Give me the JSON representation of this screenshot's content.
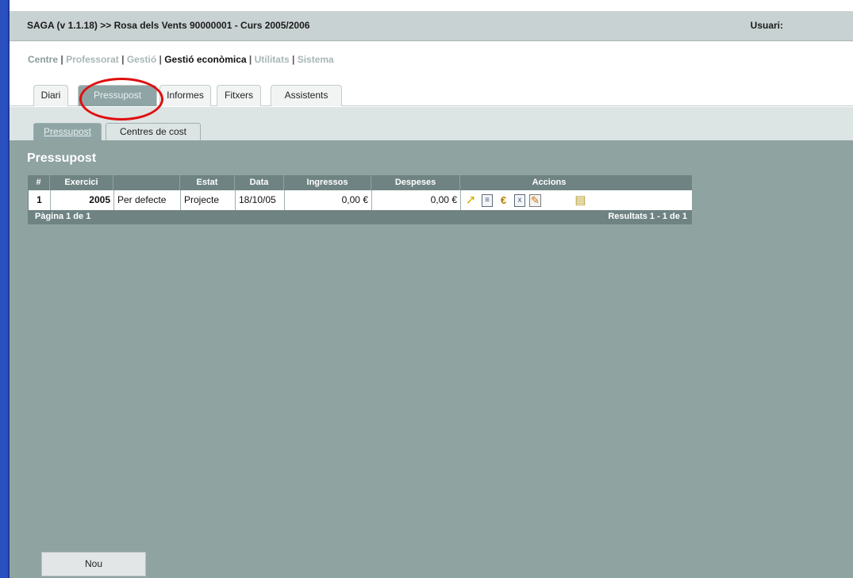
{
  "header": {
    "title": "SAGA (v 1.1.18) >> Rosa dels Vents 90000001 - Curs 2005/2006",
    "user_label": "Usuari:"
  },
  "nav": {
    "items": [
      {
        "label": "Centre",
        "style": "grey"
      },
      {
        "label": "Professorat",
        "style": "light"
      },
      {
        "label": "Gestió",
        "style": "light"
      },
      {
        "label": "Gestió econòmica",
        "style": "active"
      },
      {
        "label": "Utilitats",
        "style": "light"
      },
      {
        "label": "Sistema",
        "style": "light"
      }
    ],
    "separator": "|"
  },
  "tabs": [
    {
      "label": "Diari"
    },
    {
      "label": "Pressupost",
      "active": true
    },
    {
      "label": "Informes"
    },
    {
      "label": "Fitxers"
    },
    {
      "label": "Assistents"
    }
  ],
  "subtabs": [
    {
      "label": "Pressupost",
      "active": true
    },
    {
      "label": "Centres de cost"
    }
  ],
  "page": {
    "title": "Pressupost"
  },
  "table": {
    "columns": [
      "#",
      "Exercici",
      "",
      "Estat",
      "Data",
      "Ingressos",
      "Despeses",
      "Accions"
    ],
    "rows": [
      {
        "num": "1",
        "exercici": "2005",
        "descripcio": "Per defecte",
        "estat": "Projecte",
        "data": "18/10/05",
        "ingressos": "0,00 €",
        "despeses": "0,00 €"
      }
    ],
    "footer_left": "Pàgina 1 de 1",
    "footer_right": "Resultats 1 - 1 de 1",
    "action_icons": [
      "select-arrow-icon",
      "document-icon",
      "euro-icon",
      "excel-icon",
      "edit-pencil-icon",
      "printer-icon"
    ]
  },
  "buttons": {
    "new_label": "Nou"
  },
  "colors": {
    "content_bg": "#8fa3a1",
    "table_header": "#6f8383",
    "active_tab": "#8fa5a5",
    "annotation": "#e01010",
    "window_border": "#2a4fbf"
  }
}
